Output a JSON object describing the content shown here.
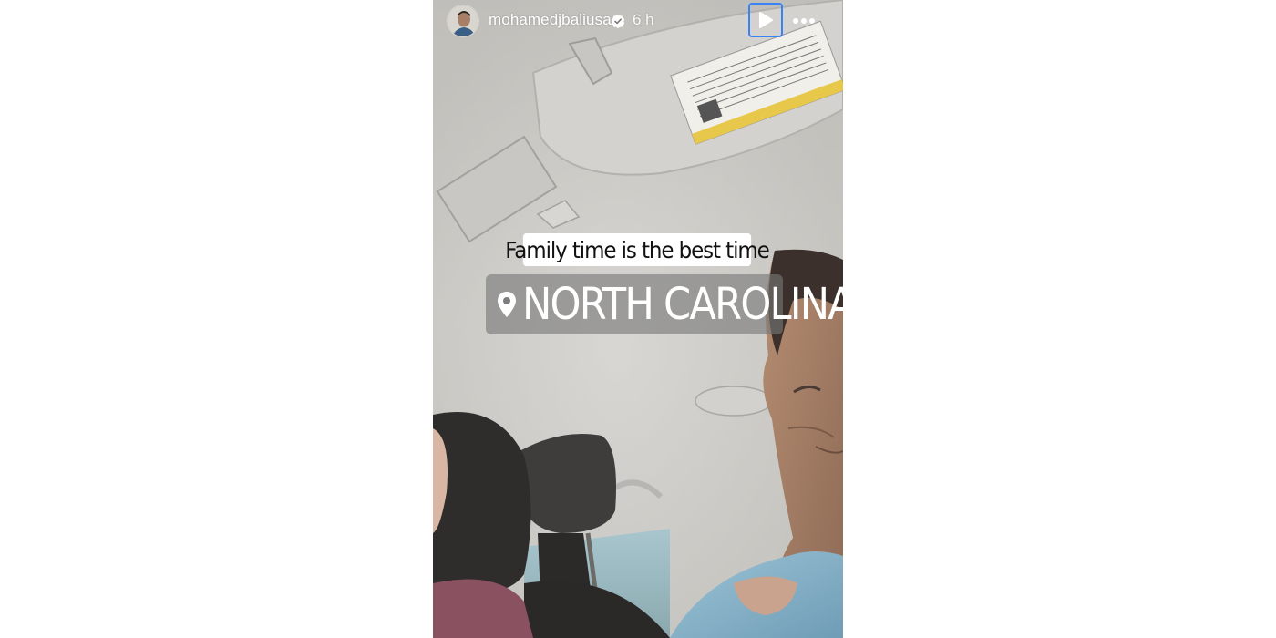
{
  "story": {
    "username": "mohamedjbaliusa",
    "verified_icon": "verified-badge-icon",
    "time_ago": "6 h",
    "play_icon": "play-icon",
    "more_icon": "more-options-icon",
    "caption": "Family time is the best time",
    "location_icon": "map-pin-icon",
    "location": "NORTH CAROLINA"
  },
  "colors": {
    "focus_outline": "#3b82f6",
    "caption_background": "#ffffff",
    "location_background": "#787878"
  }
}
